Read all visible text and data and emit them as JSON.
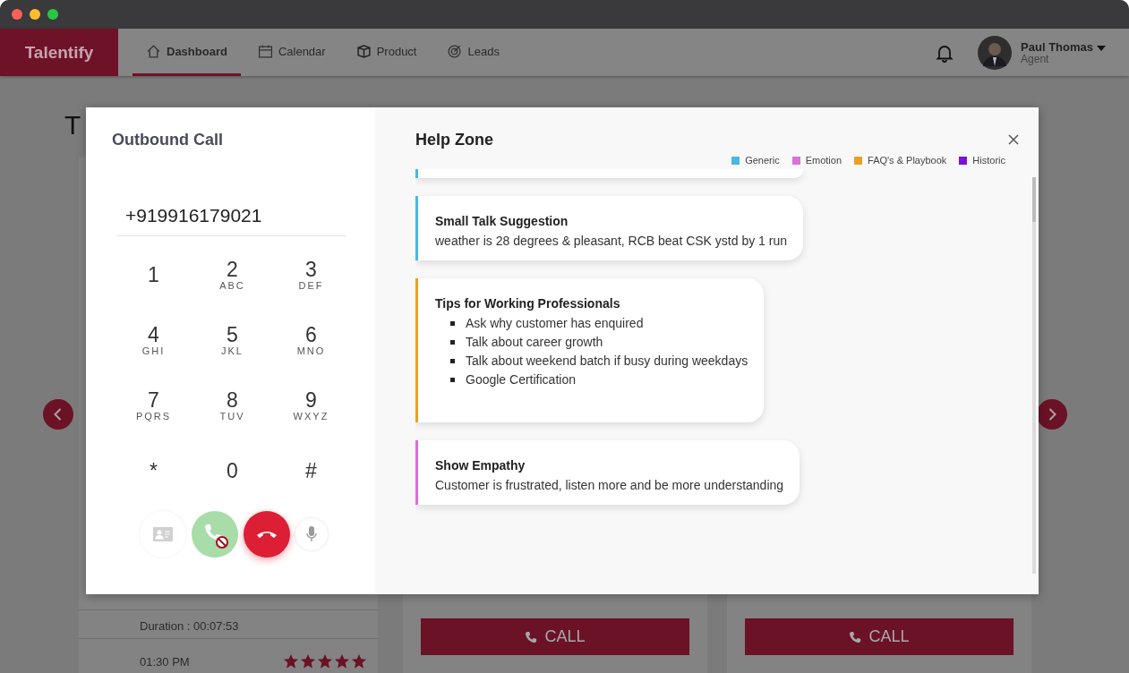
{
  "nav": {
    "brand": "Talentify",
    "tabs": [
      {
        "label": "Dashboard",
        "selected": true
      },
      {
        "label": "Calendar",
        "selected": false
      },
      {
        "label": "Product",
        "selected": false
      },
      {
        "label": "Leads",
        "selected": false
      }
    ],
    "user": {
      "name": "Paul Thomas",
      "role": "Agent"
    }
  },
  "background": {
    "heading": "T",
    "call_log": {
      "duration": "Duration : 00:07:53",
      "time": "01:30 PM",
      "stars": 5
    },
    "cards": [
      {
        "button": "CALL"
      },
      {
        "button": "CALL"
      }
    ]
  },
  "dialer": {
    "title": "Outbound Call",
    "number": "+919916179021",
    "keys": [
      {
        "digit": "1"
      },
      {
        "digit": "2",
        "letters": "ABC"
      },
      {
        "digit": "3",
        "letters": "DEF"
      },
      {
        "digit": "4",
        "letters": "GHI"
      },
      {
        "digit": "5",
        "letters": "JKL"
      },
      {
        "digit": "6",
        "letters": "MNO"
      },
      {
        "digit": "7",
        "letters": "PQRS"
      },
      {
        "digit": "8",
        "letters": "TUV"
      },
      {
        "digit": "9",
        "letters": "WXYZ"
      },
      {
        "digit": "*"
      },
      {
        "digit": "0"
      },
      {
        "digit": "#"
      }
    ]
  },
  "help_zone": {
    "title": "Help Zone",
    "legend": [
      {
        "label": "Generic",
        "color": "#4ab8dc"
      },
      {
        "label": "Emotion",
        "color": "#d870d8"
      },
      {
        "label": "FAQ's & Playbook",
        "color": "#e8a126"
      },
      {
        "label": "Historic",
        "color": "#7a12d8"
      }
    ],
    "cards": [
      {
        "kind": "partial",
        "color": "#4ab8dc"
      },
      {
        "kind": "text",
        "color": "#4ab8dc",
        "title": "Small Talk Suggestion",
        "text": "weather is 28 degrees & pleasant, RCB beat CSK ystd by 1 run"
      },
      {
        "kind": "list",
        "color": "#e8a126",
        "title": "Tips for Working Professionals",
        "items": [
          "Ask why customer has enquired",
          "Talk about career growth",
          "Talk about weekend batch if busy during weekdays",
          "Google Certification"
        ]
      },
      {
        "kind": "text",
        "color": "#d870d8",
        "title": "Show Empathy",
        "text": "Customer is frustrated, listen more and be more understanding"
      }
    ]
  }
}
